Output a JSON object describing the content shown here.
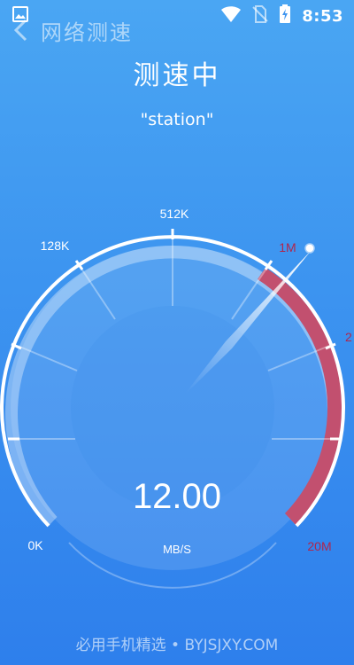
{
  "status_bar": {
    "time": "8:53",
    "icons": [
      "image-icon",
      "wifi-icon",
      "no-sim-icon",
      "battery-charging-icon"
    ]
  },
  "header": {
    "title": "网络测速",
    "back_icon": "chevron-left-icon"
  },
  "page_title": "测速中",
  "network_name": "\"station\"",
  "gauge": {
    "ticks": {
      "t0": "0K",
      "t128": "128K",
      "t512": "512K",
      "t1m": "1M",
      "t2": "2",
      "t20m": "20M"
    },
    "needle_at": "1M",
    "speed": "12.00",
    "unit": "MB/S",
    "colors": {
      "accent_red": "#c2506f",
      "needle": "#ffffff"
    }
  },
  "footer": {
    "watermark": "必用手机精选 • BYJSJXY.COM"
  }
}
